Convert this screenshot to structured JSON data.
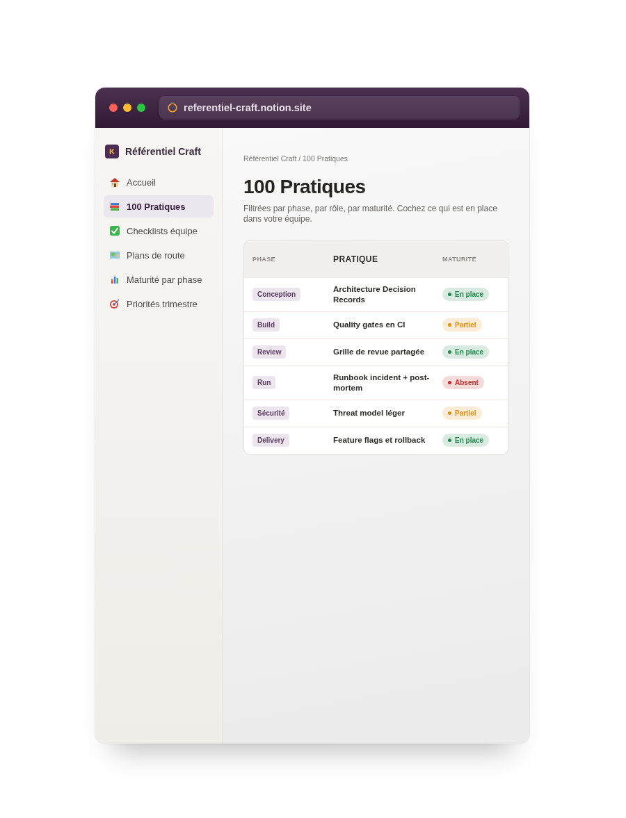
{
  "browser": {
    "url": "referentiel-craft.notion.site"
  },
  "sidebar": {
    "logo_letter": "K",
    "title": "Référentiel Craft",
    "items": [
      {
        "label": "Accueil",
        "selected": false
      },
      {
        "label": "100 Pratiques",
        "selected": true
      },
      {
        "label": "Checklists équipe",
        "selected": false
      },
      {
        "label": "Plans de route",
        "selected": false
      },
      {
        "label": "Maturité par phase",
        "selected": false
      },
      {
        "label": "Priorités trimestre",
        "selected": false
      }
    ]
  },
  "breadcrumb": "Référentiel Craft / 100 Pratiques",
  "page": {
    "title": "100 Pratiques",
    "subtitle": "Filtrées par phase, par rôle, par maturité. Cochez ce qui est en place dans votre équipe."
  },
  "table": {
    "columns": [
      {
        "label": "PHASE",
        "sorted": false
      },
      {
        "label": "PRATIQUE",
        "sorted": true
      },
      {
        "label": "MATURITÉ",
        "sorted": false
      }
    ],
    "rows": [
      {
        "phase": "Conception",
        "practice": "Architecture Decision Records",
        "maturity": {
          "label": "En place",
          "color": "#1f8a4c"
        }
      },
      {
        "phase": "Build",
        "practice": "Quality gates en CI",
        "maturity": {
          "label": "Partiel",
          "color": "#e0900f"
        }
      },
      {
        "phase": "Review",
        "practice": "Grille de revue partagée",
        "maturity": {
          "label": "En place",
          "color": "#1f8a4c"
        }
      },
      {
        "phase": "Run",
        "practice": "Runbook incident + post-mortem",
        "maturity": {
          "label": "Absent",
          "color": "#cc2b2b"
        }
      },
      {
        "phase": "Sécurité",
        "practice": "Threat model léger",
        "maturity": {
          "label": "Partiel",
          "color": "#e0900f"
        }
      },
      {
        "phase": "Delivery",
        "practice": "Feature flags et rollback",
        "maturity": {
          "label": "En place",
          "color": "#1f8a4c"
        }
      }
    ]
  }
}
